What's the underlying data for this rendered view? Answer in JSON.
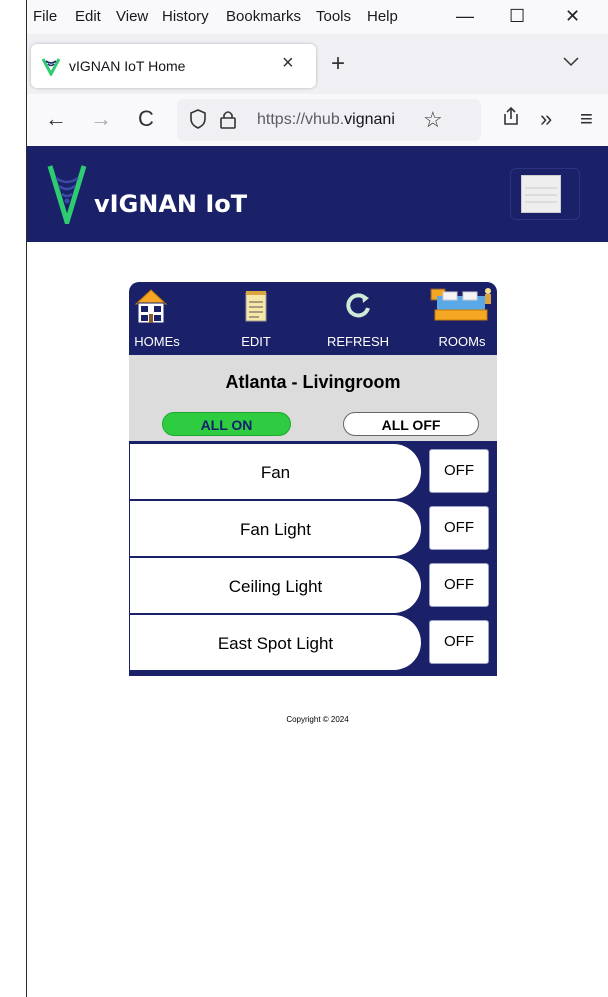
{
  "menubar": {
    "items": [
      "File",
      "Edit",
      "View",
      "History",
      "Bookmarks",
      "Tools",
      "Help"
    ]
  },
  "window_controls": {
    "minimize": "—",
    "maximize": "☐",
    "close": "✕"
  },
  "tab": {
    "title": "vIGNAN IoT Home",
    "close": "×"
  },
  "tabbar": {
    "new_tab": "+",
    "list": "⌄"
  },
  "nav": {
    "back": "←",
    "forward": "→",
    "reload": "C",
    "url_prefix": "https://vhub.",
    "url_host": "vignani",
    "bookmark": "☆",
    "overflow": "»",
    "menu": "≡"
  },
  "site": {
    "title": "vIGNAN IoT"
  },
  "toolbar": {
    "homes": "HOMEs",
    "edit": "EDIT",
    "refresh": "REFRESH",
    "rooms": "ROOMs"
  },
  "room": {
    "title": "Atlanta - Livingroom",
    "all_on": "ALL ON",
    "all_off": "ALL OFF"
  },
  "devices": [
    {
      "name": "Fan",
      "state": "OFF"
    },
    {
      "name": "Fan Light",
      "state": "OFF"
    },
    {
      "name": "Ceiling Light",
      "state": "OFF"
    },
    {
      "name": "East Spot Light",
      "state": "OFF"
    }
  ],
  "footer": {
    "copyright": "Copyright © 2024"
  },
  "colors": {
    "brand_navy": "#1a2169",
    "on_green": "#2ecc40",
    "head_gray": "#dcdcdc"
  },
  "icons": [
    "house-icon",
    "notepad-icon",
    "refresh-icon",
    "bedroom-icon",
    "vignan-logo",
    "hamburger-menu-icon"
  ]
}
